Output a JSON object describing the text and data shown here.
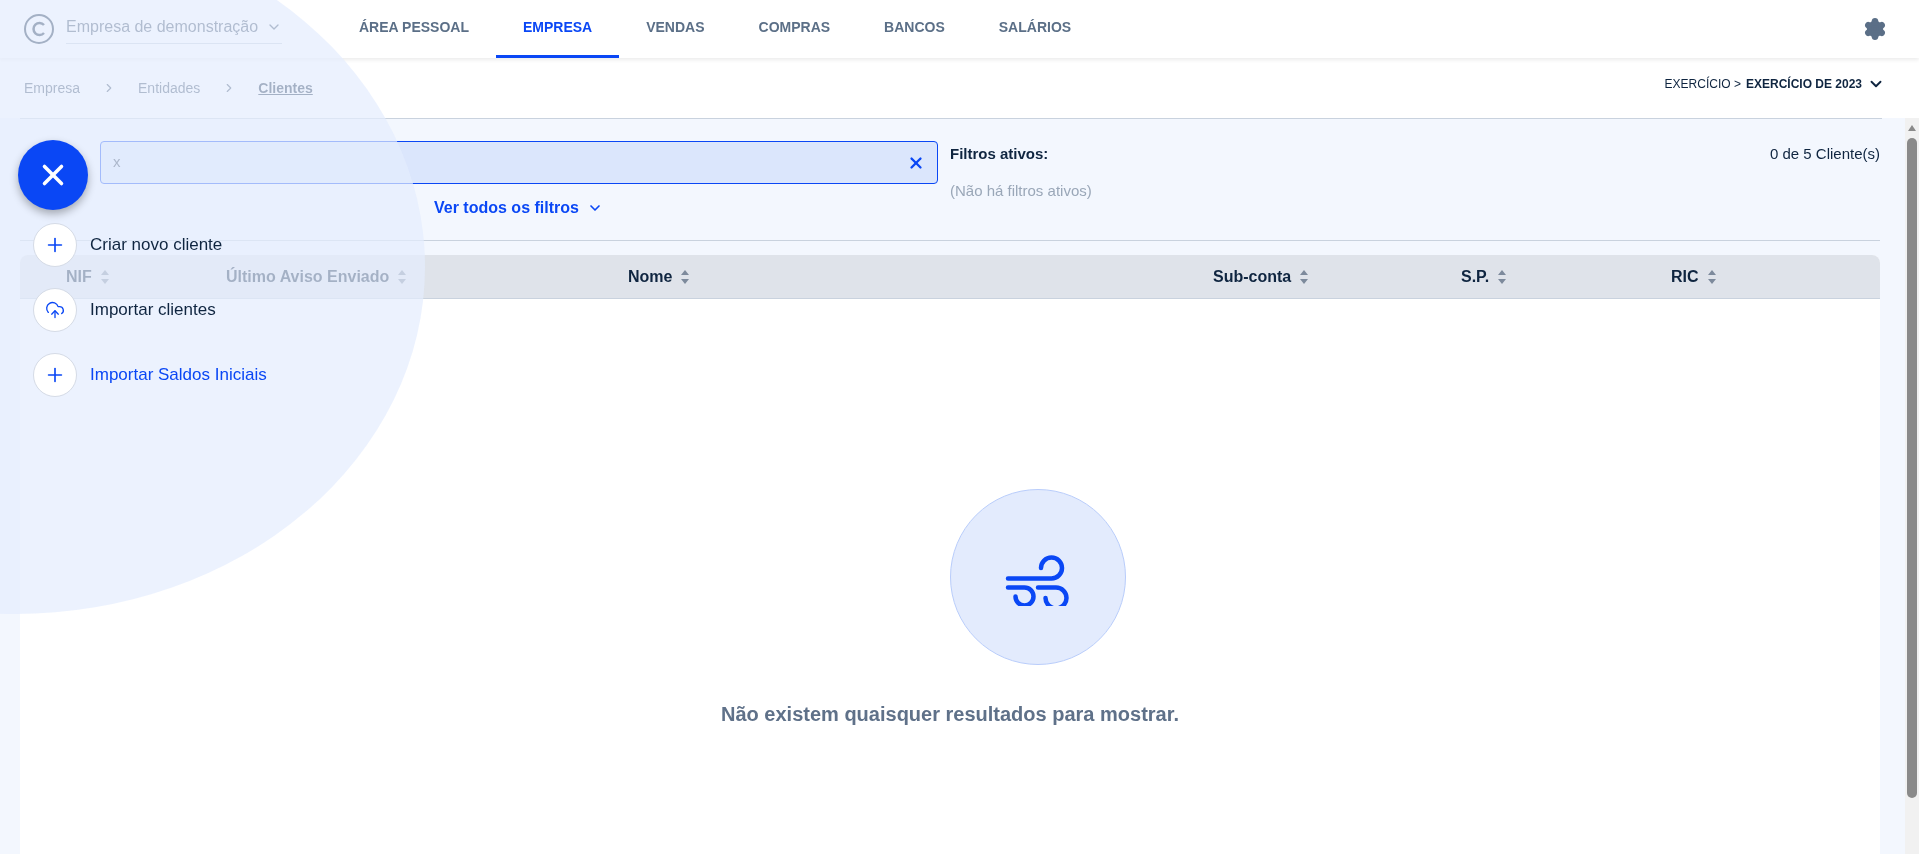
{
  "header": {
    "company": "Empresa de demonstração",
    "tabs": [
      {
        "label": "ÁREA PESSOAL",
        "selected": false
      },
      {
        "label": "EMPRESA",
        "selected": true
      },
      {
        "label": "VENDAS",
        "selected": false
      },
      {
        "label": "COMPRAS",
        "selected": false
      },
      {
        "label": "BANCOS",
        "selected": false
      },
      {
        "label": "SALÁRIOS",
        "selected": false
      }
    ]
  },
  "breadcrumb": [
    "Empresa",
    "Entidades",
    "Clientes"
  ],
  "fiscal_year": {
    "prefix": "EXERCÍCIO >",
    "value": "EXERCÍCIO DE 2023"
  },
  "search": {
    "value": "x"
  },
  "filters_link": "Ver todos os filtros",
  "active_filters": {
    "title": "Filtros ativos:",
    "empty": "(Não há filtros ativos)"
  },
  "count": "0 de 5 Cliente(s)",
  "table": {
    "columns": [
      "NIF",
      "Último Aviso Enviado",
      "Nome",
      "Sub-conta",
      "S.P.",
      "RIC"
    ]
  },
  "empty_state": {
    "message": "Não existem quaisquer resultados para mostrar."
  },
  "fab_menu": {
    "items": [
      {
        "label": "Criar novo cliente",
        "kind": "create"
      },
      {
        "label": "Importar clientes",
        "kind": "import"
      },
      {
        "label": "Importar Saldos Iniciais",
        "kind": "balances"
      }
    ]
  }
}
